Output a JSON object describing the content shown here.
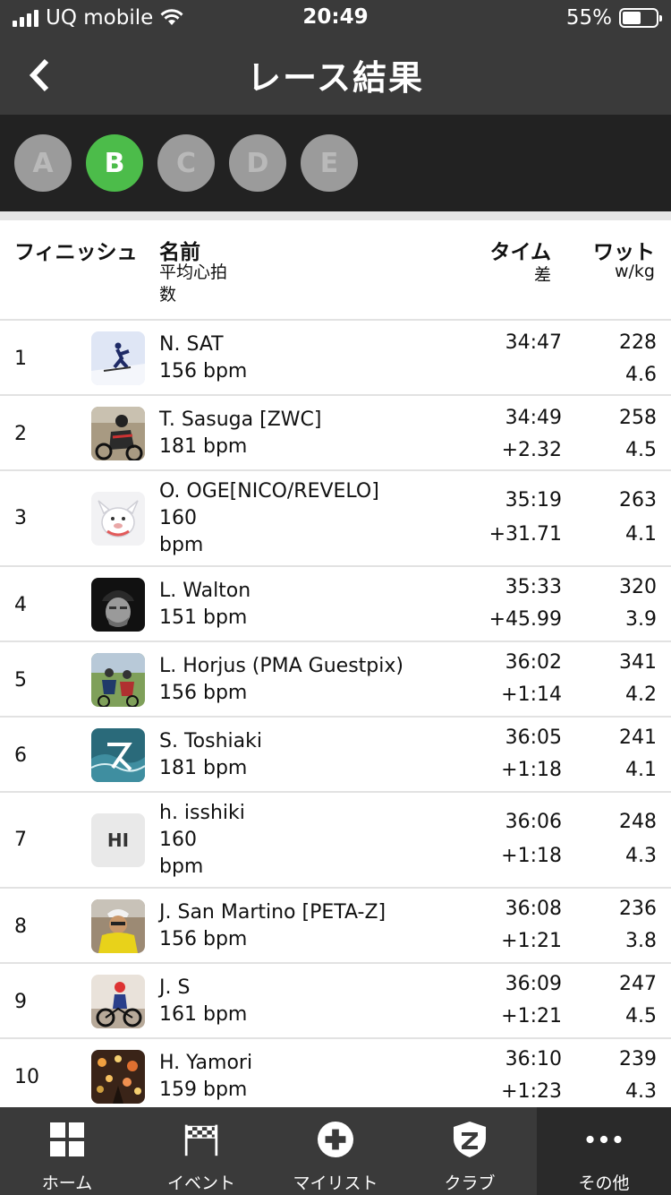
{
  "status": {
    "carrier": "UQ mobile",
    "time": "20:49",
    "battery": "55%",
    "battery_level": 0.55
  },
  "header": {
    "title": "レース結果"
  },
  "categories": [
    {
      "label": "A",
      "active": false
    },
    {
      "label": "B",
      "active": true
    },
    {
      "label": "C",
      "active": false
    },
    {
      "label": "D",
      "active": false
    },
    {
      "label": "E",
      "active": false
    }
  ],
  "table_header": {
    "finish": "フィニッシュ",
    "name": "名前",
    "avg_hr": "平均心拍数",
    "time": "タイム",
    "gap": "差",
    "watt": "ワット",
    "wkg": "w/kg"
  },
  "results": [
    {
      "rank": "1",
      "name": "N. SAT",
      "bpm": "156 bpm",
      "time": "34:47",
      "gap": "",
      "watt": "228",
      "wkg": "4.6"
    },
    {
      "rank": "2",
      "name": "T. Sasuga [ZWC]",
      "bpm": "181 bpm",
      "time": "34:49",
      "gap": "+2.32",
      "watt": "258",
      "wkg": "4.5"
    },
    {
      "rank": "3",
      "name": "O. OGE[NICO/REVELO]",
      "bpm": "160 bpm",
      "time": "35:19",
      "gap": "+31.71",
      "watt": "263",
      "wkg": "4.1"
    },
    {
      "rank": "4",
      "name": "L. Walton",
      "bpm": "151 bpm",
      "time": "35:33",
      "gap": "+45.99",
      "watt": "320",
      "wkg": "3.9"
    },
    {
      "rank": "5",
      "name": "L. Horjus (PMA Guestpix)",
      "bpm": "156 bpm",
      "time": "36:02",
      "gap": "+1:14",
      "watt": "341",
      "wkg": "4.2"
    },
    {
      "rank": "6",
      "name": "S. Toshiaki",
      "bpm": "181 bpm",
      "time": "36:05",
      "gap": "+1:18",
      "watt": "241",
      "wkg": "4.1"
    },
    {
      "rank": "7",
      "name": "h. isshiki",
      "bpm": "160 bpm",
      "initials": "HI",
      "time": "36:06",
      "gap": "+1:18",
      "watt": "248",
      "wkg": "4.3"
    },
    {
      "rank": "8",
      "name": "J. San Martino [PETA-Z]",
      "bpm": "156 bpm",
      "time": "36:08",
      "gap": "+1:21",
      "watt": "236",
      "wkg": "3.8"
    },
    {
      "rank": "9",
      "name": "J. S",
      "bpm": "161 bpm",
      "time": "36:09",
      "gap": "+1:21",
      "watt": "247",
      "wkg": "4.5"
    },
    {
      "rank": "10",
      "name": "H. Yamori",
      "bpm": "159 bpm",
      "time": "36:10",
      "gap": "+1:23",
      "watt": "239",
      "wkg": "4.3"
    }
  ],
  "tabs": [
    {
      "label": "ホーム",
      "icon": "grid-icon"
    },
    {
      "label": "イベント",
      "icon": "checkered-flag-icon"
    },
    {
      "label": "マイリスト",
      "icon": "plus-circle-icon"
    },
    {
      "label": "クラブ",
      "icon": "shield-z-icon"
    },
    {
      "label": "その他",
      "icon": "more-dots-icon"
    }
  ],
  "colors": {
    "accent": "#4cbc4a",
    "bar": "#3a3a3a",
    "inactive_category": "#9b9b9b"
  }
}
